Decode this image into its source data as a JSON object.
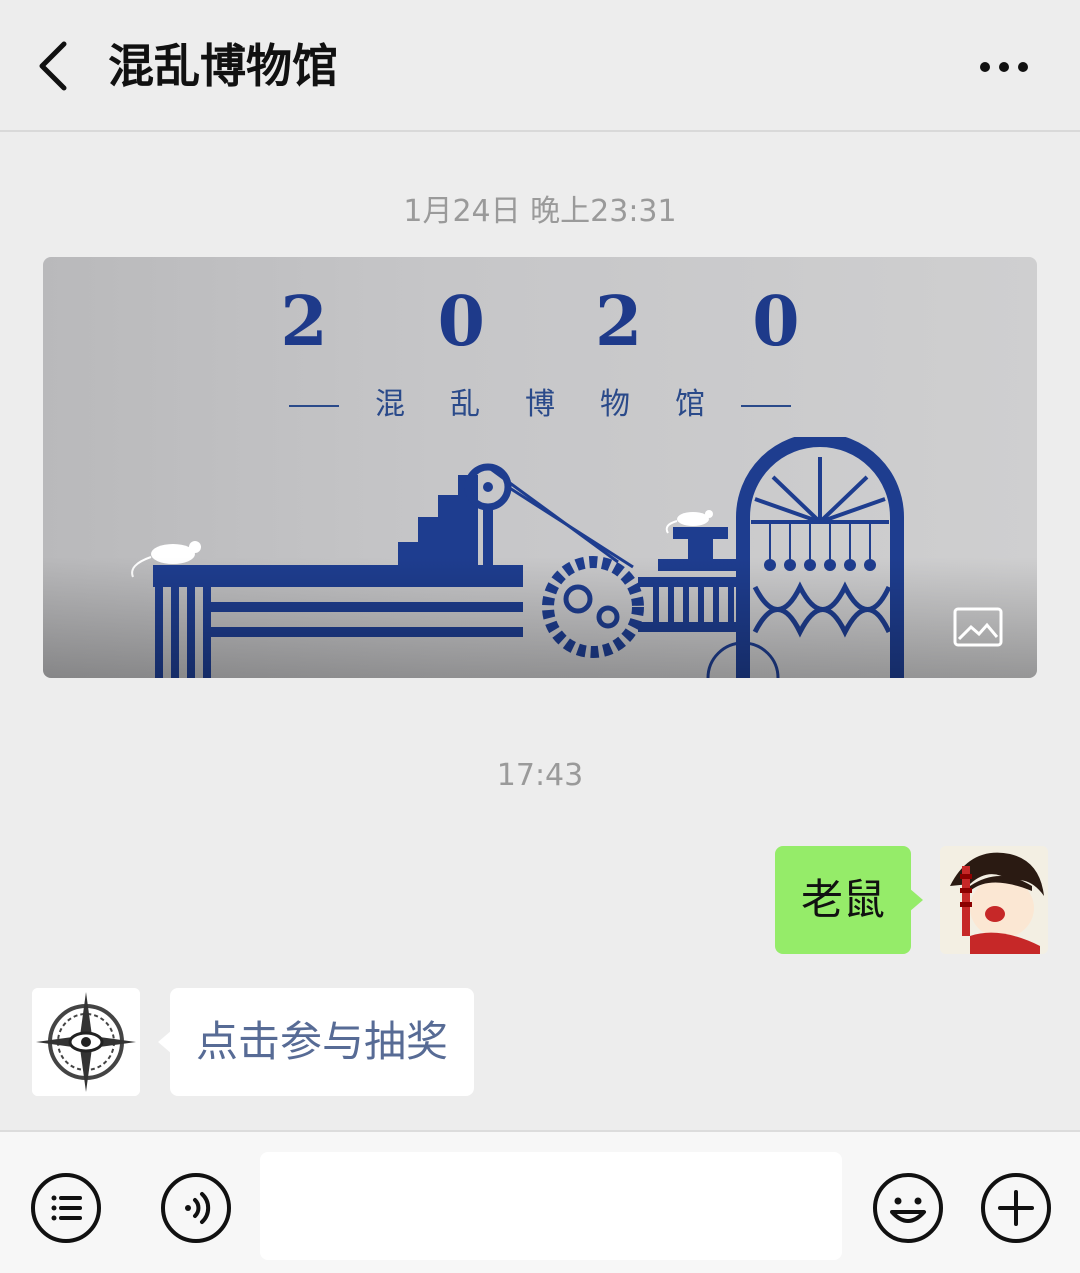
{
  "header": {
    "title": "混乱博物馆",
    "back_icon": "chevron-left-icon",
    "more_icon": "more-dots-icon"
  },
  "messages": {
    "timestamp_1": "1月24日 晚上23:31",
    "card": {
      "year": "2020",
      "subtitle": "混乱博物馆",
      "type_icon": "image-icon",
      "accent_color": "#1e3a8a"
    },
    "timestamp_2": "17:43",
    "outgoing_text": "老鼠",
    "incoming_link": "点击参与抽奖",
    "outgoing_bubble_color": "#95ec69",
    "link_color": "#576b95"
  },
  "toolbar": {
    "menu_icon": "menu-list-icon",
    "voice_icon": "voice-icon",
    "input_value": "",
    "emoji_icon": "emoji-icon",
    "plus_icon": "plus-icon"
  }
}
